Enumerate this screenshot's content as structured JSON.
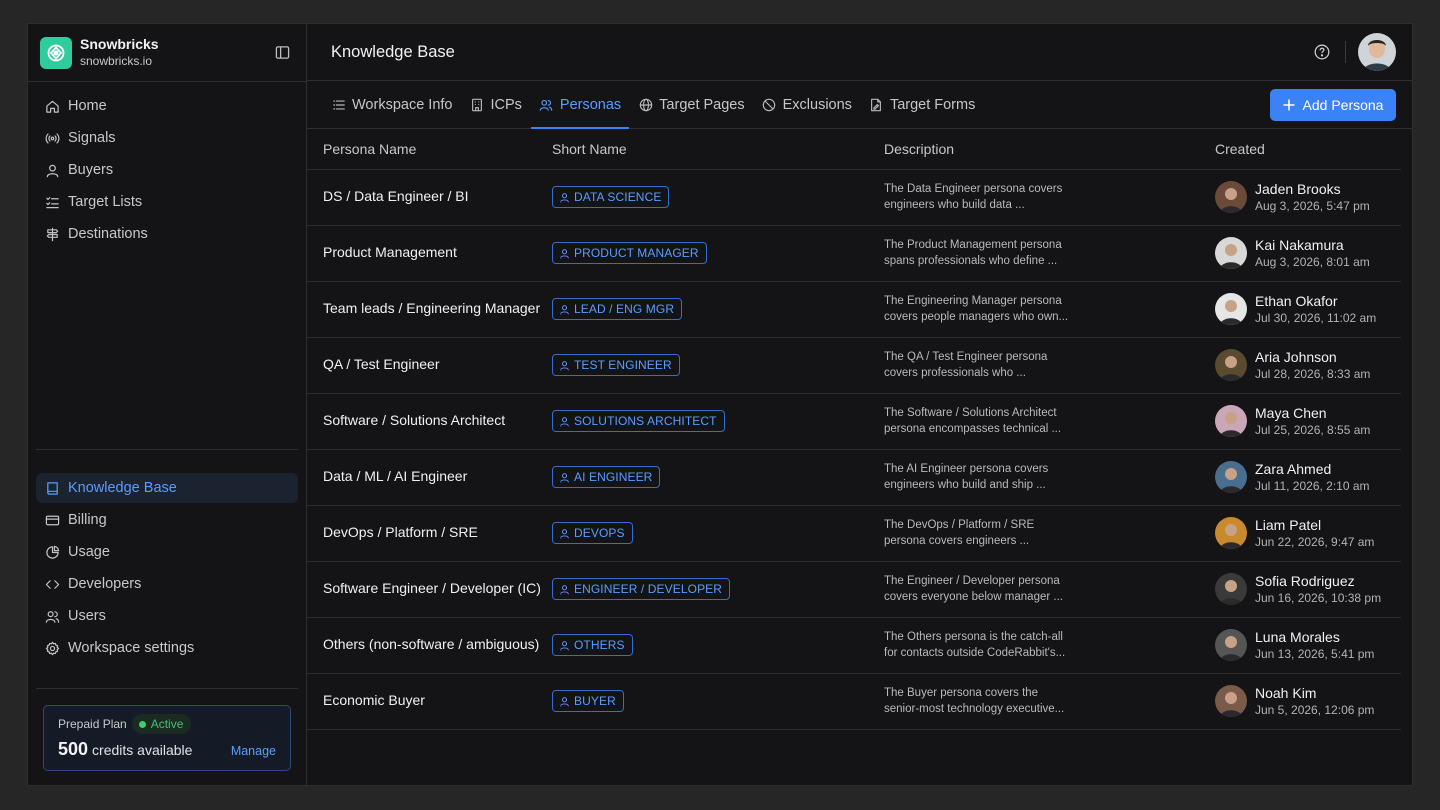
{
  "brand": {
    "name": "Snowbricks",
    "domain": "snowbricks.io",
    "accent": "#2fcc9e"
  },
  "sidebar": {
    "top_items": [
      {
        "label": "Home",
        "icon": "home-icon"
      },
      {
        "label": "Signals",
        "icon": "signal-icon"
      },
      {
        "label": "Buyers",
        "icon": "user-icon"
      },
      {
        "label": "Target Lists",
        "icon": "list-check-icon"
      },
      {
        "label": "Destinations",
        "icon": "signpost-icon"
      }
    ],
    "bottom_items": [
      {
        "label": "Knowledge Base",
        "icon": "book-icon",
        "active": true
      },
      {
        "label": "Billing",
        "icon": "credit-card-icon"
      },
      {
        "label": "Usage",
        "icon": "pie-chart-icon"
      },
      {
        "label": "Developers",
        "icon": "code-icon"
      },
      {
        "label": "Users",
        "icon": "users-icon"
      },
      {
        "label": "Workspace settings",
        "icon": "gear-icon"
      }
    ],
    "plan": {
      "label": "Prepaid Plan",
      "status": "Active",
      "credits": "500",
      "credits_text": "credits available",
      "manage": "Manage"
    }
  },
  "header": {
    "title": "Knowledge Base"
  },
  "tabs": [
    {
      "label": "Workspace Info",
      "icon": "list-icon"
    },
    {
      "label": "ICPs",
      "icon": "building-icon"
    },
    {
      "label": "Personas",
      "icon": "users-icon",
      "active": true
    },
    {
      "label": "Target Pages",
      "icon": "globe-icon"
    },
    {
      "label": "Exclusions",
      "icon": "ban-icon"
    },
    {
      "label": "Target Forms",
      "icon": "form-icon"
    }
  ],
  "add_button": "Add Persona",
  "table": {
    "columns": [
      "Persona Name",
      "Short Name",
      "Description",
      "Created"
    ],
    "rows": [
      {
        "name": "DS / Data Engineer / BI",
        "short": "DATA SCIENCE",
        "desc1": "The Data Engineer persona covers",
        "desc2": "engineers who build data ...",
        "creator": "Jaden Brooks",
        "date": "Aug 3, 2026, 5:47 pm",
        "avatar_color": "#6b4a3a"
      },
      {
        "name": "Product Management",
        "short": "PRODUCT MANAGER",
        "desc1": "The Product Management persona",
        "desc2": "spans professionals who define ...",
        "creator": "Kai Nakamura",
        "date": "Aug 3, 2026, 8:01 am",
        "avatar_color": "#d8d8d8"
      },
      {
        "name": "Team leads / Engineering Manager",
        "short": "LEAD / ENG MGR",
        "desc1": "The Engineering Manager persona",
        "desc2": "covers people managers who own...",
        "creator": "Ethan Okafor",
        "date": "Jul 30, 2026, 11:02 am",
        "avatar_color": "#e6e6e6"
      },
      {
        "name": "QA / Test Engineer",
        "short": "TEST ENGINEER",
        "desc1": "The QA / Test Engineer persona",
        "desc2": "covers professionals who ...",
        "creator": "Aria Johnson",
        "date": "Jul 28, 2026, 8:33 am",
        "avatar_color": "#5a4a2e"
      },
      {
        "name": "Software / Solutions Architect",
        "short": "SOLUTIONS ARCHITECT",
        "desc1": "The Software / Solutions Architect",
        "desc2": "persona encompasses technical ...",
        "creator": "Maya Chen",
        "date": "Jul 25, 2026, 8:55 am",
        "avatar_color": "#c9a7b8"
      },
      {
        "name": "Data / ML / AI Engineer",
        "short": "AI ENGINEER",
        "desc1": "The AI Engineer persona covers",
        "desc2": "engineers who build and ship ...",
        "creator": "Zara Ahmed",
        "date": "Jul 11, 2026, 2:10 am",
        "avatar_color": "#4a6e8e"
      },
      {
        "name": "DevOps / Platform / SRE",
        "short": "DEVOPS",
        "desc1": "The DevOps / Platform / SRE",
        "desc2": "persona covers engineers ...",
        "creator": "Liam Patel",
        "date": "Jun 22, 2026, 9:47 am",
        "avatar_color": "#c98a2e"
      },
      {
        "name": "Software Engineer / Developer (IC)",
        "short": "ENGINEER / DEVELOPER",
        "desc1": "The Engineer / Developer persona",
        "desc2": "covers everyone below manager ...",
        "creator": "Sofia Rodriguez",
        "date": "Jun 16, 2026, 10:38 pm",
        "avatar_color": "#3a3a3a"
      },
      {
        "name": "Others (non-software / ambiguous)",
        "short": "OTHERS",
        "desc1": "The Others persona is the catch-all",
        "desc2": "for contacts outside CodeRabbit's...",
        "creator": "Luna Morales",
        "date": "Jun 13, 2026, 5:41 pm",
        "avatar_color": "#555555"
      },
      {
        "name": "Economic Buyer",
        "short": "BUYER",
        "desc1": "The Buyer persona covers the",
        "desc2": "senior-most technology executive...",
        "creator": "Noah Kim",
        "date": "Jun 5, 2026, 12:06 pm",
        "avatar_color": "#7a5a48"
      }
    ]
  },
  "colors": {
    "accent": "#3b82f6",
    "active_green": "#3ecf6c",
    "background": "#141416"
  }
}
